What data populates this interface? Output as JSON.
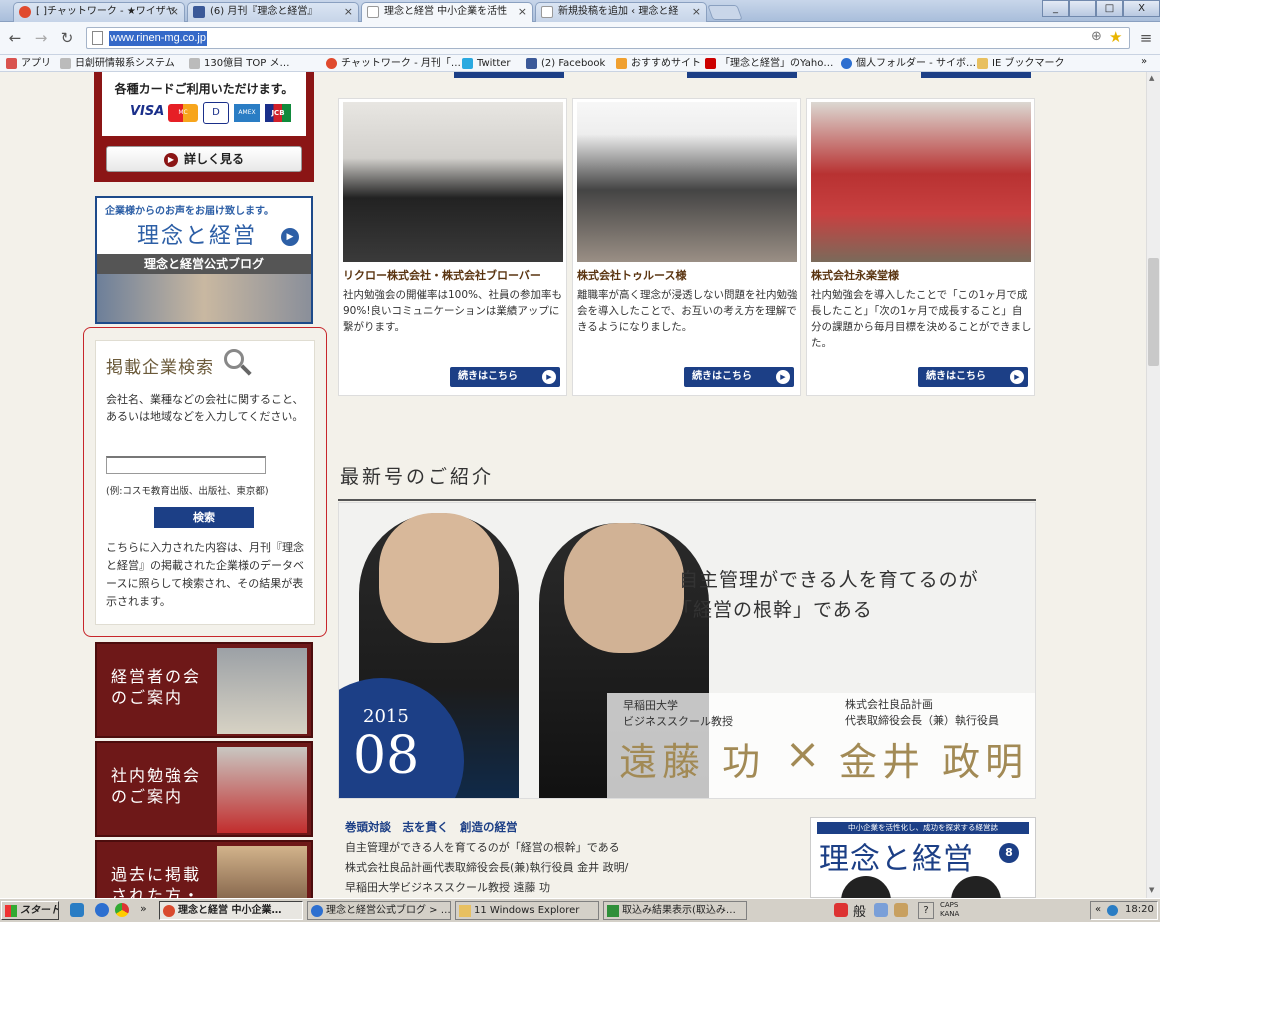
{
  "tabs": [
    {
      "label": "[ ]チャットワーク - ★ワイザヤ",
      "icon": "chatwork-icon",
      "color": "#e04a2e"
    },
    {
      "label": "(6) 月刊『理念と経営』",
      "icon": "facebook-icon",
      "color": "#3b5998"
    },
    {
      "label": "理念と経営 中小企業を活性",
      "icon": "page-icon",
      "color": "#cccccc"
    },
    {
      "label": "新規投稿を追加 ‹ 理念と経",
      "icon": "page-icon",
      "color": "#cccccc"
    }
  ],
  "window_buttons": [
    "_",
    "□",
    "X"
  ],
  "address": {
    "url": "www.rinen-mg.co.jp"
  },
  "bookmarks": [
    {
      "label": "アプリ",
      "color": "#d9534f"
    },
    {
      "label": "日創研情報系システム",
      "color": "#666"
    },
    {
      "label": "130億目 TOP メ…",
      "color": "#666"
    },
    {
      "label": "チャットワーク - 月刊「…",
      "color": "#e04a2e"
    },
    {
      "label": "Twitter",
      "color": "#2aa9e0"
    },
    {
      "label": "(2) Facebook",
      "color": "#3b5998"
    },
    {
      "label": "おすすめサイト",
      "color": "#f0a030"
    },
    {
      "label": "「理念と経営」のYaho…",
      "color": "#cc0000"
    },
    {
      "label": "個人フォルダー - サイボ…",
      "color": "#2d6fd0"
    },
    {
      "label": "IE ブックマーク",
      "color": "#e8c060"
    }
  ],
  "sidebar": {
    "card_text": "各種カードご利用いただけます。",
    "card_brands": [
      "VISA",
      "MC",
      "D",
      "AMEX",
      "JCB"
    ],
    "more_button": "詳しく見る",
    "blog_top": "企業様からのお声をお届け致します。",
    "blog_title": "理念と経営",
    "blog_sub": "理念と経営公式ブログ",
    "search": {
      "title": "掲載企業検索",
      "desc": "会社名、業種などの会社に関すること、あるいは地域などを入力してください。",
      "example": "(例:コスモ教育出版、出版社、東京都)",
      "button": "検索",
      "note": "こちらに入力された内容は、月刊『理念と経営』の掲載された企業様のデータベースに照らして検索され、その結果が表示されます。"
    },
    "banners": [
      "経営者の会\nのご案内",
      "社内勉強会\nのご案内",
      "過去に掲載\nされた方・"
    ]
  },
  "articles": [
    {
      "title": "リクロー株式会社・株式会社ブローバー",
      "desc": "社内勉強会の開催率は100%、社員の参加率も90%!良いコミュニケーションは業績アップに繋がります。",
      "button": "続きはこちら"
    },
    {
      "title": "株式会社トゥルース様",
      "desc": "離職率が高く理念が浸透しない問題を社内勉強会を導入したことで、お互いの考え方を理解できるようになりました。",
      "button": "続きはこちら"
    },
    {
      "title": "株式会社永楽堂様",
      "desc": "社内勉強会を導入したことで「この1ヶ月で成長したこと」「次の1ヶ月で成長すること」自分の課題から毎月目標を決めることができました。",
      "button": "続きはこちら"
    }
  ],
  "latest": {
    "heading": "最新号のご紹介",
    "headline1": "自主管理ができる人を育てるのが",
    "headline2": "「経営の根幹」である",
    "year": "2015",
    "month": "08",
    "left_org": "早稲田大学",
    "left_role": "ビジネススクール教授",
    "left_name": "遠藤 功",
    "right_org": "株式会社良品計画",
    "right_role": "代表取締役会長（兼）執行役員",
    "right_name": "金井 政明",
    "cross": "×",
    "feature": "巻頭対談　志を貫く　創造の経営",
    "line1": "自主管理ができる人を育てるのが「経営の根幹」である",
    "line2": "株式会社良品計画代表取締役会長(兼)執行役員 金井 政明/",
    "line3": "早稲田大学ビジネススクール教授 遠藤 功",
    "issue_top": "中小企業を活性化し、成功を探求する経営誌",
    "issue_title": "理念と経営",
    "issue_no": "8"
  },
  "taskbar": {
    "start": "スタート",
    "items": [
      {
        "label": "理念と経営 中小企業…",
        "active": true,
        "color": "#d94a2e"
      },
      {
        "label": "理念と経営公式ブログ > …",
        "active": false,
        "color": "#2d6fd0"
      },
      {
        "label": "11 Windows Explorer",
        "active": false,
        "color": "#e8c060"
      },
      {
        "label": "取込み結果表示(取込み…",
        "active": false,
        "color": "#2f8f3a"
      }
    ],
    "ime": "般",
    "caps": "CAPS",
    "kana": "KANA",
    "clock": "18:20"
  }
}
